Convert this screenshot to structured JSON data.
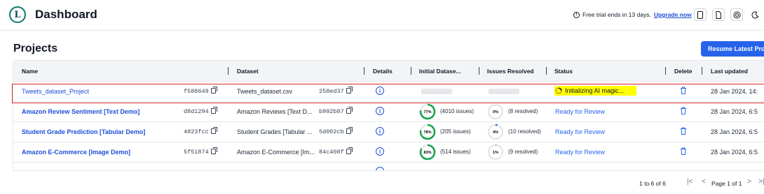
{
  "app": {
    "logo_letter": "L",
    "title": "Dashboard"
  },
  "topbar": {
    "trial_text": "Free trial ends in 13 days.",
    "upgrade_link": "Upgrade now",
    "icons": [
      "document-icon",
      "file-icon",
      "support-icon",
      "dark-mode-icon"
    ]
  },
  "page": {
    "title": "Projects",
    "resume_button": "Resume Latest Proj"
  },
  "table": {
    "columns": [
      "Name",
      "Dataset",
      "Details",
      "Initial Datase...",
      "Issues Resolved",
      "Status",
      "Delete",
      "Last updated"
    ],
    "rows": [
      {
        "name": "Tweets_dataset_Project",
        "hash": "f588649",
        "dataset": "Tweets_dataset.csv",
        "dataset_hash": "258ed37",
        "initial_pct": "",
        "initial_issues": "",
        "resolved_pct": "",
        "resolved": "",
        "status": "Initializing AI magic...",
        "updated": "28 Jan 2024, 14:"
      },
      {
        "name": "Amazon Review Sentiment [Text Demo]",
        "hash": "d8d1294",
        "dataset": "Amazon Reviews [Text D...",
        "dataset_hash": "b992b87",
        "initial_pct": "77%",
        "initial_issues": "(4010 issues)",
        "resolved_pct": "0%",
        "resolved": "(8 resolved)",
        "status": "Ready for Review",
        "updated": "28 Jan 2024, 6:5"
      },
      {
        "name": "Student Grade Prediction [Tabular Demo]",
        "hash": "4823fcc",
        "dataset": "Student Grades [Tabular ...",
        "dataset_hash": "5d002cb",
        "initial_pct": "78%",
        "initial_issues": "(205 issues)",
        "resolved_pct": "4%",
        "resolved": "(10 resolved)",
        "status": "Ready for Review",
        "updated": "28 Jan 2024, 6:5"
      },
      {
        "name": "Amazon E-Commerce [Image Demo]",
        "hash": "5f51874",
        "dataset": "Amazon E-Commerce [Im...",
        "dataset_hash": "84c408f",
        "initial_pct": "83%",
        "initial_issues": "(514 issues)",
        "resolved_pct": "1%",
        "resolved": "(9 resolved)",
        "status": "Ready for Review",
        "updated": "28 Jan 2024, 6:5"
      }
    ],
    "initial_fill": [
      0.77,
      0.78,
      0.83
    ],
    "resolved_fill": [
      0.0,
      0.04,
      0.01
    ]
  },
  "pagination": {
    "range": "1 to 6 of 6",
    "page_label": "Page 1 of 1",
    "first": "|<",
    "prev": "<",
    "next": ">",
    "last": ">|"
  },
  "colors": {
    "accent": "#2563eb",
    "ring_green": "#16a34a",
    "highlight": "#ffff00",
    "selection_outline": "#dc2626"
  }
}
